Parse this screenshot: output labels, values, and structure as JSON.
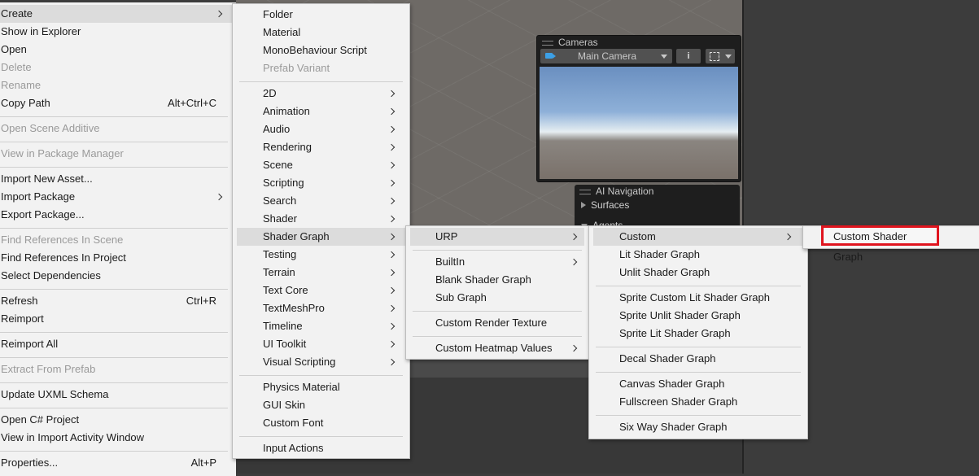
{
  "scene": {
    "cameras_overlay": {
      "title": "Cameras",
      "camera_select": "Main Camera",
      "info_glyph": "i"
    },
    "ai_navigation_overlay": {
      "title": "AI Navigation",
      "rows": [
        "Surfaces",
        "Agents"
      ]
    }
  },
  "main_menu": {
    "items": [
      {
        "label": "Create",
        "submenu": true,
        "highlighted": true
      },
      {
        "label": "Show in Explorer"
      },
      {
        "label": "Open"
      },
      {
        "label": "Delete",
        "disabled": true
      },
      {
        "label": "Rename",
        "disabled": true
      },
      {
        "label": "Copy Path",
        "shortcut": "Alt+Ctrl+C"
      },
      {
        "label": "Open Scene Additive",
        "disabled": true
      },
      {
        "label": "View in Package Manager",
        "disabled": true
      },
      {
        "label": "Import New Asset..."
      },
      {
        "label": "Import Package",
        "submenu": true
      },
      {
        "label": "Export Package..."
      },
      {
        "label": "Find References In Scene",
        "disabled": true
      },
      {
        "label": "Find References In Project"
      },
      {
        "label": "Select Dependencies"
      },
      {
        "label": "Refresh",
        "shortcut": "Ctrl+R"
      },
      {
        "label": "Reimport"
      },
      {
        "label": "Reimport All"
      },
      {
        "label": "Extract From Prefab",
        "disabled": true
      },
      {
        "label": "Update UXML Schema"
      },
      {
        "label": "Open C# Project"
      },
      {
        "label": "View in Import Activity Window"
      },
      {
        "label": "Properties...",
        "shortcut": "Alt+P"
      }
    ]
  },
  "create_menu": {
    "items": [
      {
        "label": "Folder"
      },
      {
        "label": "Material"
      },
      {
        "label": "MonoBehaviour Script"
      },
      {
        "label": "Prefab Variant",
        "disabled": true
      },
      {
        "label": "2D",
        "submenu": true
      },
      {
        "label": "Animation",
        "submenu": true
      },
      {
        "label": "Audio",
        "submenu": true
      },
      {
        "label": "Rendering",
        "submenu": true
      },
      {
        "label": "Scene",
        "submenu": true
      },
      {
        "label": "Scripting",
        "submenu": true
      },
      {
        "label": "Search",
        "submenu": true
      },
      {
        "label": "Shader",
        "submenu": true
      },
      {
        "label": "Shader Graph",
        "submenu": true,
        "highlighted": true
      },
      {
        "label": "Testing",
        "submenu": true
      },
      {
        "label": "Terrain",
        "submenu": true
      },
      {
        "label": "Text Core",
        "submenu": true
      },
      {
        "label": "TextMeshPro",
        "submenu": true
      },
      {
        "label": "Timeline",
        "submenu": true
      },
      {
        "label": "UI Toolkit",
        "submenu": true
      },
      {
        "label": "Visual Scripting",
        "submenu": true
      },
      {
        "label": "Physics Material"
      },
      {
        "label": "GUI Skin"
      },
      {
        "label": "Custom Font"
      },
      {
        "label": "Input Actions"
      }
    ]
  },
  "shader_graph_menu": {
    "items": [
      {
        "label": "URP",
        "submenu": true,
        "highlighted": true
      },
      {
        "label": "BuiltIn",
        "submenu": true
      },
      {
        "label": "Blank Shader Graph"
      },
      {
        "label": "Sub Graph"
      },
      {
        "label": "Custom Render Texture"
      },
      {
        "label": "Custom Heatmap Values",
        "submenu": true
      }
    ]
  },
  "urp_menu": {
    "items": [
      {
        "label": "Custom",
        "submenu": true,
        "highlighted": true
      },
      {
        "label": "Lit Shader Graph"
      },
      {
        "label": "Unlit Shader Graph"
      },
      {
        "label": "Sprite Custom Lit Shader Graph"
      },
      {
        "label": "Sprite Unlit Shader Graph"
      },
      {
        "label": "Sprite Lit Shader Graph"
      },
      {
        "label": "Decal Shader Graph"
      },
      {
        "label": "Canvas Shader Graph"
      },
      {
        "label": "Fullscreen Shader Graph"
      },
      {
        "label": "Six Way Shader Graph"
      }
    ]
  },
  "custom_menu": {
    "items": [
      {
        "label": "Custom Shader Graph",
        "outlined": true
      }
    ]
  },
  "colors": {
    "menu_bg": "#f2f2f2",
    "highlight_bg": "#dcdcdc",
    "disabled_text": "#9a9a9a",
    "callout_red": "#e0141e",
    "scene_bg": "#6e6a66",
    "editor_dark": "#3c3c3c"
  }
}
